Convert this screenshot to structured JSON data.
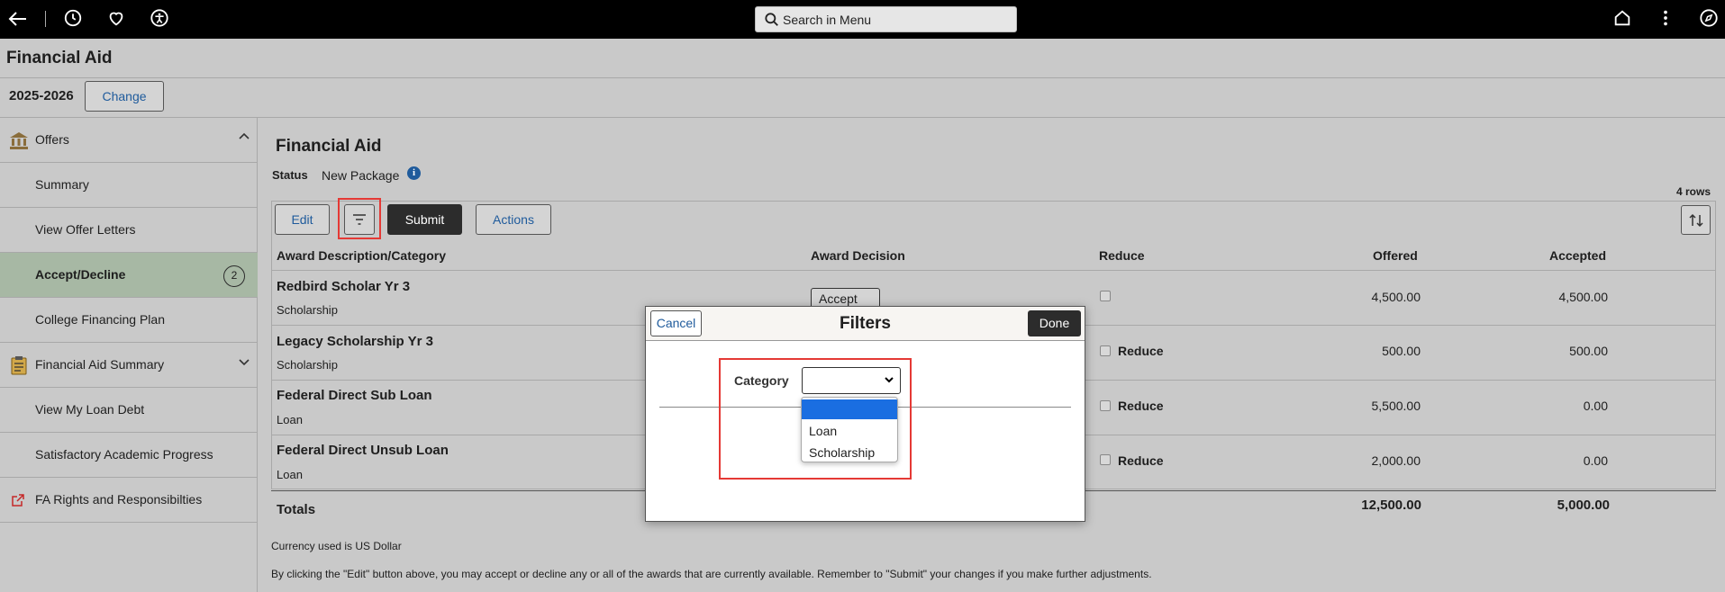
{
  "topbar": {
    "search_placeholder": "Search in Menu",
    "icons": [
      "back-arrow-icon",
      "history-icon",
      "heart-icon",
      "accessibility-icon",
      "home-icon",
      "kebab-icon",
      "compass-icon"
    ]
  },
  "header": {
    "title": "Financial Aid",
    "year": "2025-2026",
    "change_label": "Change"
  },
  "sidebar": {
    "items": [
      {
        "label": "Offers"
      },
      {
        "label": "Summary"
      },
      {
        "label": "View Offer Letters"
      },
      {
        "label": "Accept/Decline",
        "badge": "2"
      },
      {
        "label": "College Financing Plan"
      },
      {
        "label": "Financial Aid Summary"
      },
      {
        "label": "View My Loan Debt"
      },
      {
        "label": "Satisfactory Academic Progress"
      },
      {
        "label": "FA Rights and Responsibilties"
      }
    ]
  },
  "main": {
    "title": "Financial Aid",
    "status_label": "Status",
    "status_value": "New Package",
    "rows_count": "4 rows",
    "toolbar": {
      "edit": "Edit",
      "submit": "Submit",
      "actions": "Actions"
    },
    "columns": [
      "Award Description/Category",
      "Award Decision",
      "Reduce",
      "Offered",
      "Accepted"
    ],
    "rows": [
      {
        "name": "Redbird Scholar Yr 3",
        "category": "Scholarship",
        "decision": "Accept",
        "reduce": "",
        "offered": "4,500.00",
        "accepted": "4,500.00"
      },
      {
        "name": "Legacy Scholarship Yr 3",
        "category": "Scholarship",
        "decision": "",
        "reduce": "Reduce",
        "offered": "500.00",
        "accepted": "500.00"
      },
      {
        "name": "Federal Direct Sub Loan",
        "category": "Loan",
        "decision": "",
        "reduce": "Reduce",
        "offered": "5,500.00",
        "accepted": "0.00"
      },
      {
        "name": "Federal Direct Unsub Loan",
        "category": "Loan",
        "decision": "",
        "reduce": "Reduce",
        "offered": "2,000.00",
        "accepted": "0.00"
      }
    ],
    "totals": {
      "label": "Totals",
      "offered": "12,500.00",
      "accepted": "5,000.00"
    },
    "currency_note": "Currency used is US Dollar",
    "instructions": "By clicking the \"Edit\" button above, you may accept or decline any or all of the awards that are currently available. Remember to \"Submit\" your changes if you make further adjustments."
  },
  "modal": {
    "cancel": "Cancel",
    "title": "Filters",
    "done": "Done",
    "category_label": "Category",
    "category_value": "",
    "options": [
      "",
      "Loan",
      "Scholarship"
    ]
  },
  "colors": {
    "topbar": "#000000",
    "active_nav": "#a7b8a4",
    "link": "#1f5b9c",
    "highlight": "#e53935",
    "selected_option": "#1a6ee1"
  }
}
